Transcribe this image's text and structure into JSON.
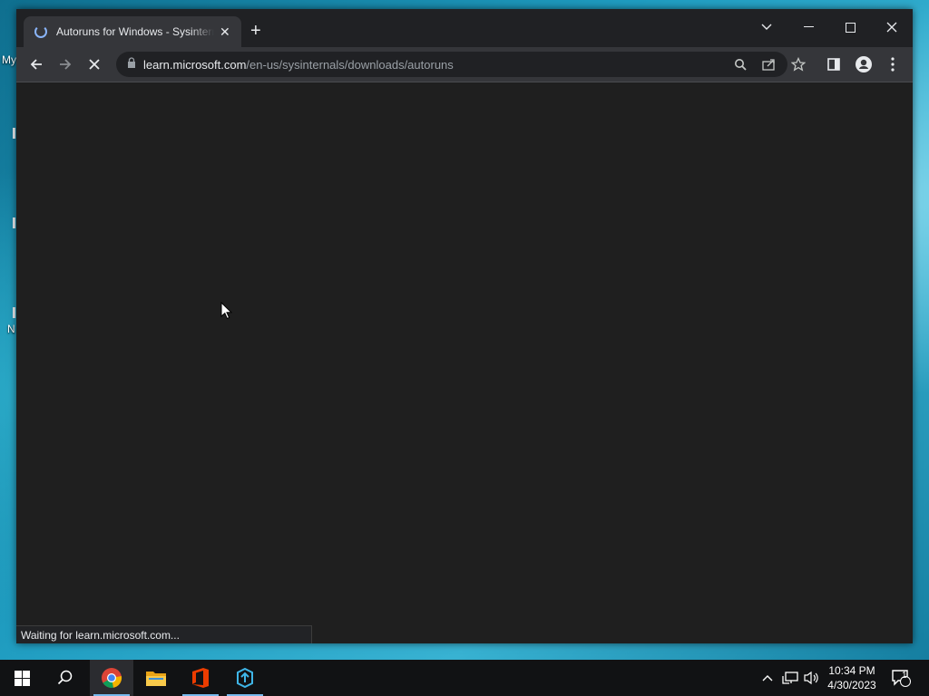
{
  "desktop": {
    "labels": [
      "My",
      "N"
    ]
  },
  "browser": {
    "tab": {
      "title": "Autoruns for Windows - Sysinternals"
    },
    "address": {
      "host": "learn.microsoft.com",
      "path": "/en-us/sysinternals/downloads/autoruns"
    },
    "status_text": "Waiting for learn.microsoft.com..."
  },
  "taskbar": {
    "clock": {
      "time": "10:34 PM",
      "date": "4/30/2023"
    },
    "notification_count": "1"
  },
  "colors": {
    "accent": "#8ab4f8",
    "taskbar_active_underline": "#76b9ed"
  }
}
